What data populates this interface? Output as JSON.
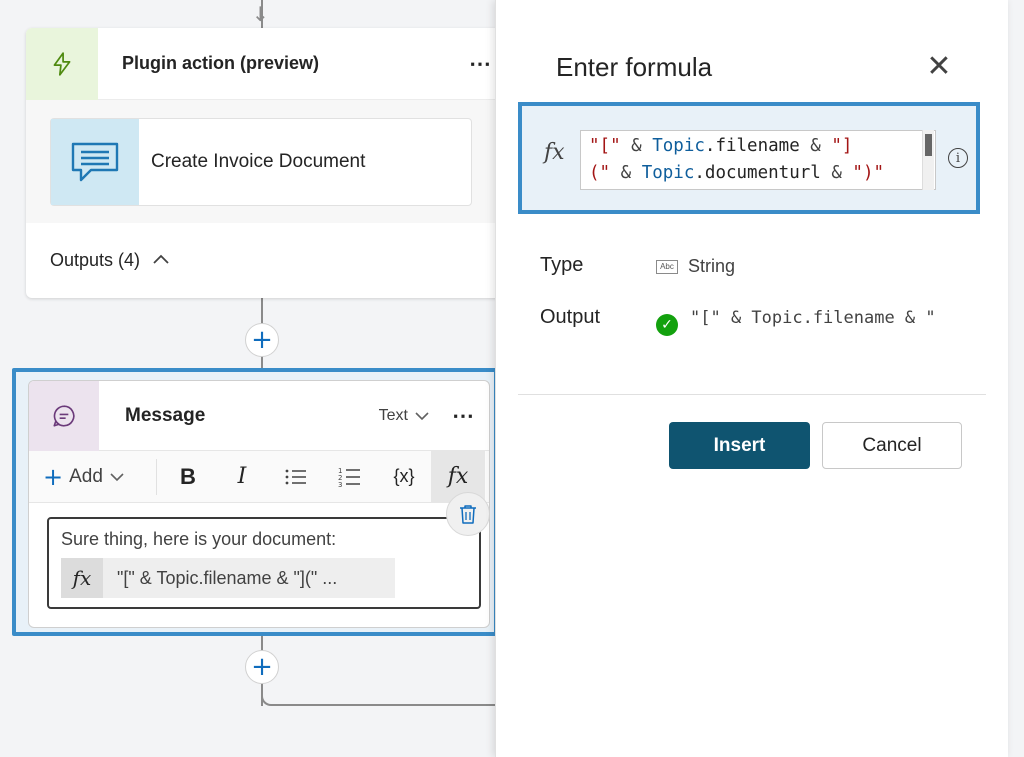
{
  "canvas": {
    "plugin_card": {
      "title": "Plugin action (preview)",
      "more_label": "⋯",
      "invoice_label": "Create Invoice Document",
      "outputs_label": "Outputs (4)"
    },
    "message_card": {
      "title": "Message",
      "type_select": "Text",
      "more_label": "⋯",
      "toolbar": {
        "add_label": "Add",
        "bold_label": "B",
        "italic_label": "I",
        "variable_label": "{x}",
        "fx_label": "fx"
      },
      "body_text": "Sure thing, here is your document:",
      "fx_chip_label": "fx",
      "fx_chip_value": "\"[\" & Topic.filename & \"](\" ..."
    }
  },
  "formula_panel": {
    "title": "Enter formula",
    "fx_label": "fx",
    "formula": {
      "line1": [
        "\"[\"",
        " & ",
        "Topic",
        ".filename",
        " & ",
        "\"]"
      ],
      "line2": [
        "(\"",
        " & ",
        "Topic",
        ".documenturl",
        " & ",
        "\")\""
      ]
    },
    "type_label": "Type",
    "type_icon_text": "Abc",
    "type_value": "String",
    "output_label": "Output",
    "output_value": "\"[\" & Topic.filename & \"",
    "insert_label": "Insert",
    "cancel_label": "Cancel"
  },
  "icons": {
    "plugin": "lightning-icon",
    "invoice": "chat-document-icon",
    "message": "message-bubble-icon",
    "close": "close-icon",
    "info": "info-icon",
    "check": "check-circle-icon",
    "trash": "trash-icon"
  },
  "colors": {
    "accent_blue": "#3a8cc8",
    "primary_button": "#0f5470",
    "success_green": "#13a10e",
    "plugin_icon_bg": "#e9f5dc",
    "message_icon_bg": "#ece3ee"
  }
}
